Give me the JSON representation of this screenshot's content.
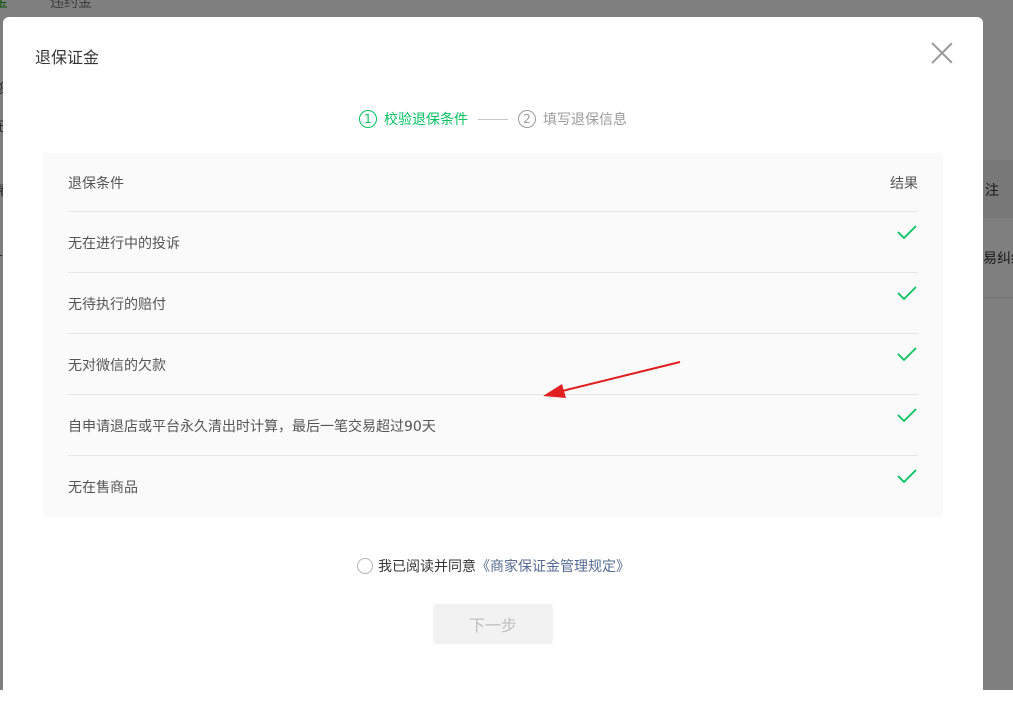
{
  "background": {
    "tab_active": "金",
    "tab_other": "违约金",
    "column_header": "注",
    "column_cell": "易纠纷",
    "left_marks": [
      "货",
      "已",
      "看",
      "-"
    ]
  },
  "dialog": {
    "title": "退保证金",
    "close_icon": "close-icon"
  },
  "steps": [
    {
      "number": "1",
      "label": "校验退保条件",
      "state": "active"
    },
    {
      "number": "2",
      "label": "填写退保信息",
      "state": "inactive"
    }
  ],
  "table": {
    "header_condition": "退保条件",
    "header_result": "结果",
    "rows": [
      {
        "condition": "无在进行中的投诉",
        "result_icon": "check-icon"
      },
      {
        "condition": "无待执行的赔付",
        "result_icon": "check-icon"
      },
      {
        "condition": "无对微信的欠款",
        "result_icon": "check-icon"
      },
      {
        "condition": "自申请退店或平台永久清出时计算，最后一笔交易超过90天",
        "result_icon": "check-icon"
      },
      {
        "condition": "无在售商品",
        "result_icon": "check-icon"
      }
    ]
  },
  "agreement": {
    "text": "我已阅读并同意",
    "link": "《商家保证金管理规定》",
    "checked": false
  },
  "next_button": {
    "label": "下一步",
    "enabled": false
  },
  "colors": {
    "accent": "#07c160",
    "link": "#576b95",
    "annotation_arrow": "#e02020"
  }
}
